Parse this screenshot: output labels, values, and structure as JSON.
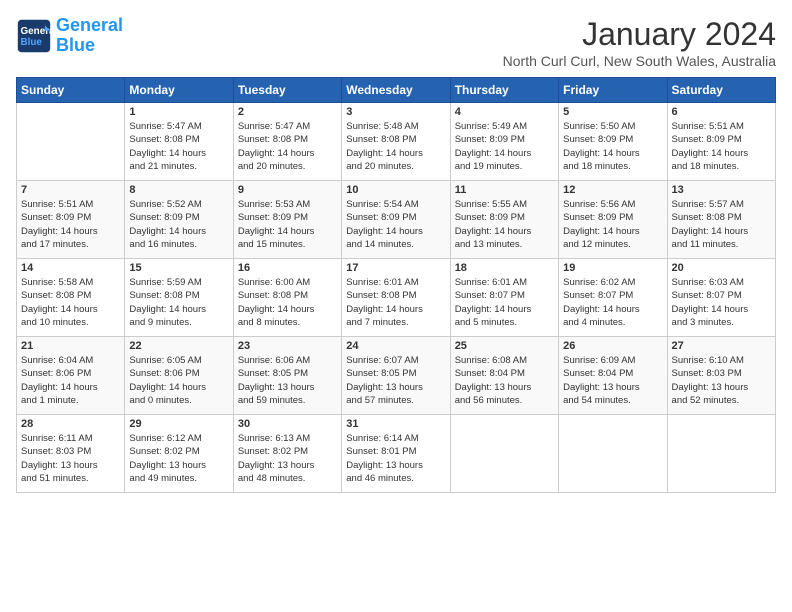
{
  "header": {
    "logo_line1": "General",
    "logo_line2": "Blue",
    "month": "January 2024",
    "location": "North Curl Curl, New South Wales, Australia"
  },
  "weekdays": [
    "Sunday",
    "Monday",
    "Tuesday",
    "Wednesday",
    "Thursday",
    "Friday",
    "Saturday"
  ],
  "weeks": [
    [
      {
        "day": "",
        "info": ""
      },
      {
        "day": "1",
        "info": "Sunrise: 5:47 AM\nSunset: 8:08 PM\nDaylight: 14 hours\nand 21 minutes."
      },
      {
        "day": "2",
        "info": "Sunrise: 5:47 AM\nSunset: 8:08 PM\nDaylight: 14 hours\nand 20 minutes."
      },
      {
        "day": "3",
        "info": "Sunrise: 5:48 AM\nSunset: 8:08 PM\nDaylight: 14 hours\nand 20 minutes."
      },
      {
        "day": "4",
        "info": "Sunrise: 5:49 AM\nSunset: 8:09 PM\nDaylight: 14 hours\nand 19 minutes."
      },
      {
        "day": "5",
        "info": "Sunrise: 5:50 AM\nSunset: 8:09 PM\nDaylight: 14 hours\nand 18 minutes."
      },
      {
        "day": "6",
        "info": "Sunrise: 5:51 AM\nSunset: 8:09 PM\nDaylight: 14 hours\nand 18 minutes."
      }
    ],
    [
      {
        "day": "7",
        "info": "Sunrise: 5:51 AM\nSunset: 8:09 PM\nDaylight: 14 hours\nand 17 minutes."
      },
      {
        "day": "8",
        "info": "Sunrise: 5:52 AM\nSunset: 8:09 PM\nDaylight: 14 hours\nand 16 minutes."
      },
      {
        "day": "9",
        "info": "Sunrise: 5:53 AM\nSunset: 8:09 PM\nDaylight: 14 hours\nand 15 minutes."
      },
      {
        "day": "10",
        "info": "Sunrise: 5:54 AM\nSunset: 8:09 PM\nDaylight: 14 hours\nand 14 minutes."
      },
      {
        "day": "11",
        "info": "Sunrise: 5:55 AM\nSunset: 8:09 PM\nDaylight: 14 hours\nand 13 minutes."
      },
      {
        "day": "12",
        "info": "Sunrise: 5:56 AM\nSunset: 8:09 PM\nDaylight: 14 hours\nand 12 minutes."
      },
      {
        "day": "13",
        "info": "Sunrise: 5:57 AM\nSunset: 8:08 PM\nDaylight: 14 hours\nand 11 minutes."
      }
    ],
    [
      {
        "day": "14",
        "info": "Sunrise: 5:58 AM\nSunset: 8:08 PM\nDaylight: 14 hours\nand 10 minutes."
      },
      {
        "day": "15",
        "info": "Sunrise: 5:59 AM\nSunset: 8:08 PM\nDaylight: 14 hours\nand 9 minutes."
      },
      {
        "day": "16",
        "info": "Sunrise: 6:00 AM\nSunset: 8:08 PM\nDaylight: 14 hours\nand 8 minutes."
      },
      {
        "day": "17",
        "info": "Sunrise: 6:01 AM\nSunset: 8:08 PM\nDaylight: 14 hours\nand 7 minutes."
      },
      {
        "day": "18",
        "info": "Sunrise: 6:01 AM\nSunset: 8:07 PM\nDaylight: 14 hours\nand 5 minutes."
      },
      {
        "day": "19",
        "info": "Sunrise: 6:02 AM\nSunset: 8:07 PM\nDaylight: 14 hours\nand 4 minutes."
      },
      {
        "day": "20",
        "info": "Sunrise: 6:03 AM\nSunset: 8:07 PM\nDaylight: 14 hours\nand 3 minutes."
      }
    ],
    [
      {
        "day": "21",
        "info": "Sunrise: 6:04 AM\nSunset: 8:06 PM\nDaylight: 14 hours\nand 1 minute."
      },
      {
        "day": "22",
        "info": "Sunrise: 6:05 AM\nSunset: 8:06 PM\nDaylight: 14 hours\nand 0 minutes."
      },
      {
        "day": "23",
        "info": "Sunrise: 6:06 AM\nSunset: 8:05 PM\nDaylight: 13 hours\nand 59 minutes."
      },
      {
        "day": "24",
        "info": "Sunrise: 6:07 AM\nSunset: 8:05 PM\nDaylight: 13 hours\nand 57 minutes."
      },
      {
        "day": "25",
        "info": "Sunrise: 6:08 AM\nSunset: 8:04 PM\nDaylight: 13 hours\nand 56 minutes."
      },
      {
        "day": "26",
        "info": "Sunrise: 6:09 AM\nSunset: 8:04 PM\nDaylight: 13 hours\nand 54 minutes."
      },
      {
        "day": "27",
        "info": "Sunrise: 6:10 AM\nSunset: 8:03 PM\nDaylight: 13 hours\nand 52 minutes."
      }
    ],
    [
      {
        "day": "28",
        "info": "Sunrise: 6:11 AM\nSunset: 8:03 PM\nDaylight: 13 hours\nand 51 minutes."
      },
      {
        "day": "29",
        "info": "Sunrise: 6:12 AM\nSunset: 8:02 PM\nDaylight: 13 hours\nand 49 minutes."
      },
      {
        "day": "30",
        "info": "Sunrise: 6:13 AM\nSunset: 8:02 PM\nDaylight: 13 hours\nand 48 minutes."
      },
      {
        "day": "31",
        "info": "Sunrise: 6:14 AM\nSunset: 8:01 PM\nDaylight: 13 hours\nand 46 minutes."
      },
      {
        "day": "",
        "info": ""
      },
      {
        "day": "",
        "info": ""
      },
      {
        "day": "",
        "info": ""
      }
    ]
  ]
}
